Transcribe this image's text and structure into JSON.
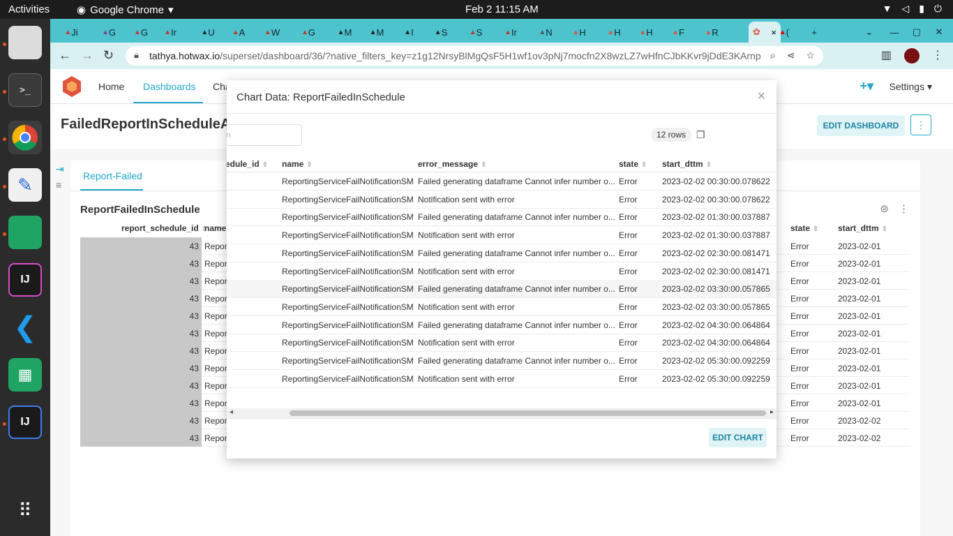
{
  "system": {
    "activities": "Activities",
    "app_name": "Google Chrome",
    "clock": "Feb 2  11:15 AM"
  },
  "browser": {
    "url_host": "tathya.hotwax.io",
    "url_path": "/superset/dashboard/36/?native_filters_key=z1g12NrsyBlMgQsF5H1wf1ov3pNj7mocfn2X8wzLZ7wHfnCJbKKvr9jDdE3KArnp",
    "tab_letters": [
      "Ji",
      "G",
      "G",
      "Ir",
      "U",
      "A",
      "W",
      "G",
      "M",
      "M",
      "I",
      "S",
      "S",
      "Ir",
      "N",
      "H",
      "H",
      "H",
      "F",
      "R",
      "("
    ],
    "active_tab_close": "×",
    "new_tab": "+"
  },
  "superset": {
    "nav": {
      "home": "Home",
      "dashboards": "Dashboards",
      "charts": "Cha",
      "settings": "Settings"
    },
    "dashboard_title": "FailedReportInScheduleAr",
    "edit_dashboard": "EDIT DASHBOARD",
    "more": "⋮",
    "tab_label": "Report-Failed",
    "chart_title": "ReportFailedInSchedule",
    "bg_headers": {
      "report_schedule_id": "report_schedule_id",
      "name": "name",
      "state": "state",
      "start_dttm": "start_dttm"
    },
    "bg_rows": [
      {
        "id": "43",
        "name": "Repor",
        "state": "Error",
        "date": "2023-02-01"
      },
      {
        "id": "43",
        "name": "Repor",
        "state": "Error",
        "date": "2023-02-01"
      },
      {
        "id": "43",
        "name": "Repor",
        "state": "Error",
        "date": "2023-02-01"
      },
      {
        "id": "43",
        "name": "Repor",
        "state": "Error",
        "date": "2023-02-01"
      },
      {
        "id": "43",
        "name": "Repor",
        "state": "Error",
        "date": "2023-02-01"
      },
      {
        "id": "43",
        "name": "Repor",
        "state": "Error",
        "date": "2023-02-01"
      },
      {
        "id": "43",
        "name": "Repor",
        "state": "Error",
        "date": "2023-02-01"
      },
      {
        "id": "43",
        "name": "Repor",
        "state": "Error",
        "date": "2023-02-01"
      },
      {
        "id": "43",
        "name": "Repor",
        "state": "Error",
        "date": "2023-02-01"
      },
      {
        "id": "43",
        "name": "Repor",
        "state": "Error",
        "date": "2023-02-01"
      },
      {
        "id": "43",
        "name": "Repor",
        "state": "Error",
        "date": "2023-02-02"
      },
      {
        "id": "43",
        "name": "Repor",
        "state": "Error",
        "date": "2023-02-02"
      }
    ]
  },
  "modal": {
    "title": "Chart Data: ReportFailedInSchedule",
    "close": "×",
    "search_placeholder": "n",
    "rows_count": "12 rows",
    "headers": {
      "id": "edule_id",
      "name": "name",
      "error_message": "error_message",
      "state": "state",
      "start_dttm": "start_dttm"
    },
    "rows": [
      {
        "name": "ReportingServiceFailNotificationSM",
        "msg": "Failed generating dataframe Cannot infer number o...",
        "state": "Error",
        "dttm": "2023-02-02 00:30:00.078622"
      },
      {
        "name": "ReportingServiceFailNotificationSM",
        "msg": "Notification sent with error",
        "state": "Error",
        "dttm": "2023-02-02 00:30:00.078622"
      },
      {
        "name": "ReportingServiceFailNotificationSM",
        "msg": "Failed generating dataframe Cannot infer number o...",
        "state": "Error",
        "dttm": "2023-02-02 01:30:00.037887"
      },
      {
        "name": "ReportingServiceFailNotificationSM",
        "msg": "Notification sent with error",
        "state": "Error",
        "dttm": "2023-02-02 01:30:00.037887"
      },
      {
        "name": "ReportingServiceFailNotificationSM",
        "msg": "Failed generating dataframe Cannot infer number o...",
        "state": "Error",
        "dttm": "2023-02-02 02:30:00.081471"
      },
      {
        "name": "ReportingServiceFailNotificationSM",
        "msg": "Notification sent with error",
        "state": "Error",
        "dttm": "2023-02-02 02:30:00.081471"
      },
      {
        "name": "ReportingServiceFailNotificationSM",
        "msg": "Failed generating dataframe Cannot infer number o...",
        "state": "Error",
        "dttm": "2023-02-02 03:30:00.057865"
      },
      {
        "name": "ReportingServiceFailNotificationSM",
        "msg": "Notification sent with error",
        "state": "Error",
        "dttm": "2023-02-02 03:30:00.057865"
      },
      {
        "name": "ReportingServiceFailNotificationSM",
        "msg": "Failed generating dataframe Cannot infer number o...",
        "state": "Error",
        "dttm": "2023-02-02 04:30:00.064864"
      },
      {
        "name": "ReportingServiceFailNotificationSM",
        "msg": "Notification sent with error",
        "state": "Error",
        "dttm": "2023-02-02 04:30:00.064864"
      },
      {
        "name": "ReportingServiceFailNotificationSM",
        "msg": "Failed generating dataframe Cannot infer number o...",
        "state": "Error",
        "dttm": "2023-02-02 05:30:00.092259"
      },
      {
        "name": "ReportingServiceFailNotificationSM",
        "msg": "Notification sent with error",
        "state": "Error",
        "dttm": "2023-02-02 05:30:00.092259"
      }
    ],
    "highlighted_row_index": 6,
    "edit_chart": "EDIT CHART"
  },
  "colors": {
    "accent": "#20a7c9",
    "tab_bar": "#4dc4cd",
    "dock": "#2b2b2b",
    "topbar": "#1c1c1c"
  },
  "icons": [
    "activities-icon",
    "wifi-icon",
    "volume-icon",
    "battery-icon",
    "power-icon",
    "back-icon",
    "forward-icon",
    "reload-icon",
    "lock-icon",
    "zoom-icon",
    "share-icon",
    "star-icon",
    "sidebar-icon",
    "profile-icon",
    "menu-icon",
    "close-icon",
    "copy-icon",
    "filter-icon"
  ]
}
